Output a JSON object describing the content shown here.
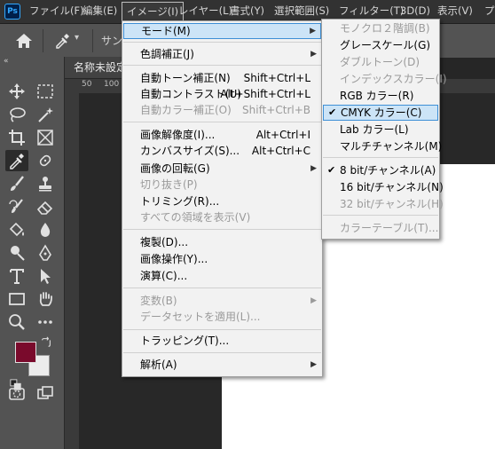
{
  "menubar": {
    "logo": "Ps",
    "items": [
      "ファイル(F)",
      "編集(E)",
      "イメージ(I)",
      "レイヤー(L)",
      "書式(Y)",
      "選択範囲(S)",
      "フィルター(T)",
      "3D(D)",
      "表示(V)",
      "プ"
    ]
  },
  "options_bar": {
    "sample_label": "サン"
  },
  "toolbar": {
    "collapse": "«",
    "foreground_color": "#7a0a2c",
    "background_color": "#ececec"
  },
  "document": {
    "tab_title": "名称未設定",
    "ruler_marks": [
      "50",
      "100"
    ]
  },
  "image_menu": {
    "items": [
      {
        "label": "モード(M)",
        "submenu": true,
        "highlighted": true
      },
      {
        "label": "色調補正(J)",
        "submenu": true
      },
      {
        "label": "自動トーン補正(N)",
        "shortcut": "Shift+Ctrl+L"
      },
      {
        "label": "自動コントラスト(U)",
        "shortcut": "Alt+Shift+Ctrl+L"
      },
      {
        "label": "自動カラー補正(O)",
        "shortcut": "Shift+Ctrl+B",
        "disabled": true
      },
      {
        "label": "画像解像度(I)...",
        "shortcut": "Alt+Ctrl+I"
      },
      {
        "label": "カンバスサイズ(S)...",
        "shortcut": "Alt+Ctrl+C"
      },
      {
        "label": "画像の回転(G)",
        "submenu": true
      },
      {
        "label": "切り抜き(P)",
        "disabled": true
      },
      {
        "label": "トリミング(R)..."
      },
      {
        "label": "すべての領域を表示(V)",
        "disabled": true
      },
      {
        "label": "複製(D)..."
      },
      {
        "label": "画像操作(Y)..."
      },
      {
        "label": "演算(C)..."
      },
      {
        "label": "変数(B)",
        "submenu": true,
        "disabled": true
      },
      {
        "label": "データセットを適用(L)...",
        "disabled": true
      },
      {
        "label": "トラッピング(T)..."
      },
      {
        "label": "解析(A)",
        "submenu": true
      }
    ]
  },
  "mode_submenu": {
    "items": [
      {
        "label": "モノクロ２階調(B)",
        "disabled": true
      },
      {
        "label": "グレースケール(G)"
      },
      {
        "label": "ダブルトーン(D)",
        "disabled": true
      },
      {
        "label": "インデックスカラー(I)",
        "disabled": true
      },
      {
        "label": "RGB カラー(R)"
      },
      {
        "label": "CMYK カラー(C)",
        "checked": true,
        "highlighted": true
      },
      {
        "label": "Lab カラー(L)"
      },
      {
        "label": "マルチチャンネル(M)"
      },
      {
        "label": "8 bit/チャンネル(A)",
        "checked": true
      },
      {
        "label": "16 bit/チャンネル(N)"
      },
      {
        "label": "32 bit/チャンネル(H)",
        "disabled": true
      },
      {
        "label": "カラーテーブル(T)...",
        "disabled": true
      }
    ],
    "check_mark": "✔"
  }
}
